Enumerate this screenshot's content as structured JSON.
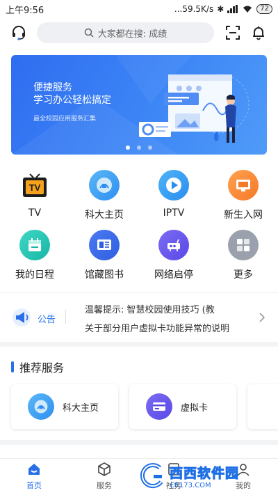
{
  "status_bar": {
    "time": "上午9:56",
    "speed": "...59.5K/s",
    "battery": "72"
  },
  "header": {
    "search_placeholder": "大家都在搜: 成绩"
  },
  "banner": {
    "title_line1": "便捷服务",
    "title_line2": "学习办公轻松搞定",
    "subtitle": "最全校园应用服务汇集",
    "dots": 3,
    "active_dot": 1
  },
  "grid": [
    {
      "label": "TV",
      "icon": "tv-icon"
    },
    {
      "label": "科大主页",
      "icon": "campus-homepage-icon"
    },
    {
      "label": "IPTV",
      "icon": "iptv-play-icon"
    },
    {
      "label": "新生入网",
      "icon": "new-student-network-icon"
    },
    {
      "label": "我的日程",
      "icon": "calendar-icon"
    },
    {
      "label": "馆藏图书",
      "icon": "library-books-icon"
    },
    {
      "label": "网络启停",
      "icon": "network-toggle-icon"
    },
    {
      "label": "更多",
      "icon": "more-icon"
    }
  ],
  "notice": {
    "label": "公告",
    "lines": [
      "温馨提示: 智慧校园使用技巧 (教",
      "关于部分用户虚拟卡功能异常的说明"
    ]
  },
  "recommend": {
    "title": "推荐服务",
    "cards": [
      {
        "label": "科大主页"
      },
      {
        "label": "虚拟卡"
      }
    ]
  },
  "bottom_nav": [
    {
      "label": "首页",
      "active": true
    },
    {
      "label": "服务",
      "active": false
    },
    {
      "label": "社务",
      "active": false
    },
    {
      "label": "我的",
      "active": false
    }
  ],
  "watermark": {
    "text": "西西软件园",
    "url": "CR173.COM"
  },
  "colors": {
    "accent": "#2a6fe8",
    "banner": "#3d86f6"
  }
}
